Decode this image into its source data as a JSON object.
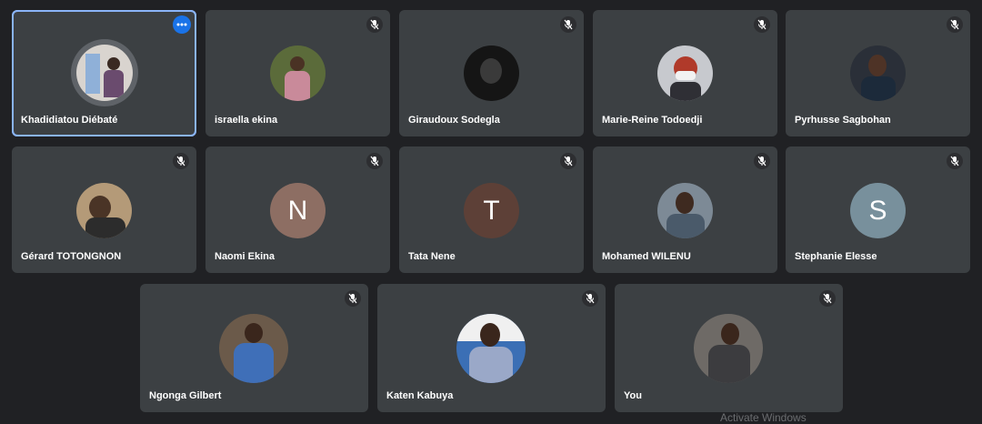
{
  "participants": [
    {
      "name": "Khadidiatou Diébaté",
      "avatar": "photo",
      "avatar_color": "#d9d4cf",
      "muted": false,
      "active": true,
      "menu_icon": "more-options-icon"
    },
    {
      "name": "israella ekina",
      "avatar": "photo",
      "avatar_color": "#5b6b3a",
      "muted": true
    },
    {
      "name": "Giraudoux Sodegla",
      "avatar": "photo",
      "avatar_color": "#151515",
      "muted": true
    },
    {
      "name": "Marie-Reine Todoedji",
      "avatar": "photo",
      "avatar_color": "#c7c9ce",
      "muted": true
    },
    {
      "name": "Pyrhusse Sagbohan",
      "avatar": "photo",
      "avatar_color": "#2a2f38",
      "muted": true
    },
    {
      "name": "Gérard TOTONGNON",
      "avatar": "photo",
      "avatar_color": "#b49a78",
      "muted": true
    },
    {
      "name": "Naomi Ekina",
      "avatar": "letter",
      "letter": "N",
      "avatar_color": "#8d6e63",
      "muted": true
    },
    {
      "name": "Tata Nene",
      "avatar": "letter",
      "letter": "T",
      "avatar_color": "#5d4037",
      "muted": true
    },
    {
      "name": "Mohamed WILENU",
      "avatar": "photo",
      "avatar_color": "#7d8a96",
      "muted": true
    },
    {
      "name": "Stephanie Elesse",
      "avatar": "letter",
      "letter": "S",
      "avatar_color": "#78909c",
      "muted": true
    },
    {
      "name": "Ngonga Gilbert",
      "avatar": "photo",
      "avatar_color": "#4a6da0",
      "muted": true
    },
    {
      "name": "Katen Kabuya",
      "avatar": "photo",
      "avatar_color": "#3b6fb5",
      "muted": true
    },
    {
      "name": "You",
      "avatar": "photo",
      "avatar_color": "#6e6a66",
      "muted": true
    }
  ],
  "watermark": "Activate Windows",
  "colors": {
    "background": "#202124",
    "tile": "#3c4043",
    "active_border": "#8ab4f8",
    "more_button": "#1a73e8"
  }
}
